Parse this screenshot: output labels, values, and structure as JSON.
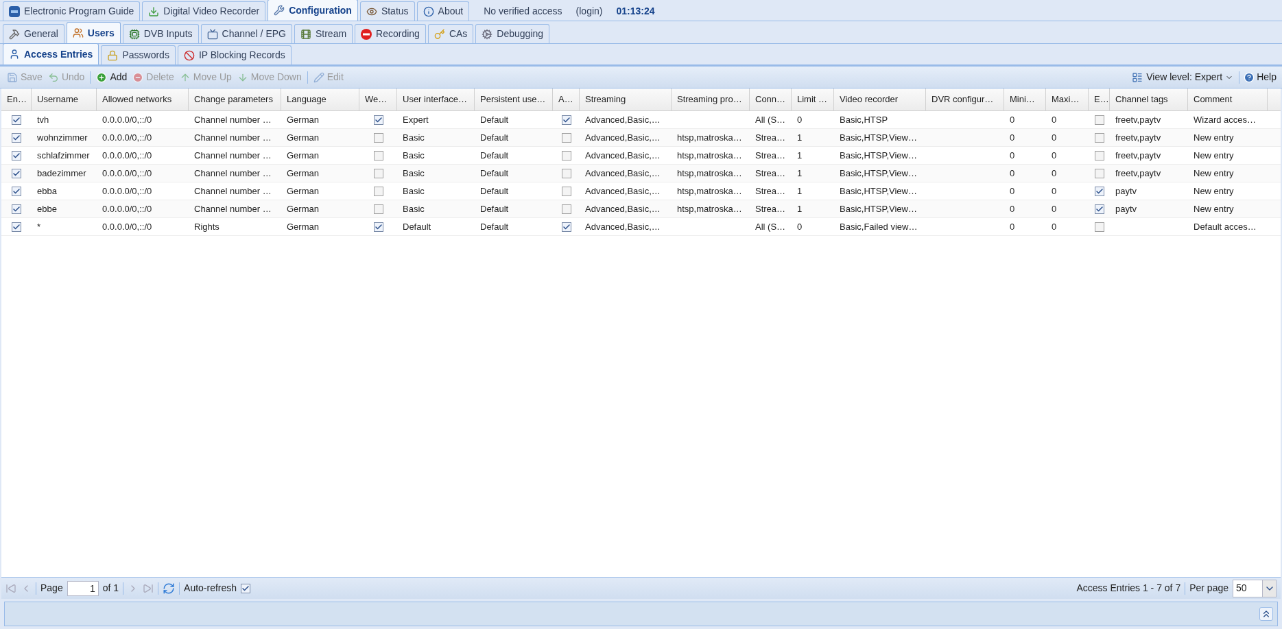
{
  "main_tabs": [
    {
      "label": "Electronic Program Guide",
      "selected": false
    },
    {
      "label": "Digital Video Recorder",
      "selected": false
    },
    {
      "label": "Configuration",
      "selected": true
    },
    {
      "label": "Status",
      "selected": false
    },
    {
      "label": "About",
      "selected": false
    }
  ],
  "session": {
    "access": "No verified access",
    "login": "(login)",
    "time": "01:13:24"
  },
  "config_tabs": [
    {
      "label": "General",
      "selected": false
    },
    {
      "label": "Users",
      "selected": true
    },
    {
      "label": "DVB Inputs",
      "selected": false
    },
    {
      "label": "Channel / EPG",
      "selected": false
    },
    {
      "label": "Stream",
      "selected": false
    },
    {
      "label": "Recording",
      "selected": false
    },
    {
      "label": "CAs",
      "selected": false
    },
    {
      "label": "Debugging",
      "selected": false
    }
  ],
  "user_tabs": [
    {
      "label": "Access Entries",
      "selected": true
    },
    {
      "label": "Passwords",
      "selected": false
    },
    {
      "label": "IP Blocking Records",
      "selected": false
    }
  ],
  "toolbar": [
    {
      "label": "Save",
      "disabled": true
    },
    {
      "label": "Undo",
      "disabled": true
    },
    {
      "label": "Add",
      "disabled": false
    },
    {
      "label": "Delete",
      "disabled": true
    },
    {
      "label": "Move Up",
      "disabled": true
    },
    {
      "label": "Move Down",
      "disabled": true
    },
    {
      "label": "Edit",
      "disabled": true
    }
  ],
  "view_level": "View level: Expert",
  "help": "Help",
  "table": {
    "columns": [
      {
        "label": "En…",
        "kind": "check"
      },
      {
        "label": "Username",
        "kind": "text"
      },
      {
        "label": "Allowed networks",
        "kind": "text"
      },
      {
        "label": "Change parameters",
        "kind": "text"
      },
      {
        "label": "Language",
        "kind": "text"
      },
      {
        "label": "We…",
        "kind": "check"
      },
      {
        "label": "User interface…",
        "kind": "text"
      },
      {
        "label": "Persistent use…",
        "kind": "text"
      },
      {
        "label": "A…",
        "kind": "check"
      },
      {
        "label": "Streaming",
        "kind": "text"
      },
      {
        "label": "Streaming pro…",
        "kind": "text"
      },
      {
        "label": "Conn…",
        "kind": "text"
      },
      {
        "label": "Limit …",
        "kind": "text"
      },
      {
        "label": "Video recorder",
        "kind": "text"
      },
      {
        "label": "DVR configur…",
        "kind": "text"
      },
      {
        "label": "Mini…",
        "kind": "text"
      },
      {
        "label": "Maxi…",
        "kind": "text"
      },
      {
        "label": "E…",
        "kind": "check"
      },
      {
        "label": "Channel tags",
        "kind": "text"
      },
      {
        "label": "Comment",
        "kind": "text"
      }
    ],
    "rows": [
      {
        "cells": [
          {
            "checked": true
          },
          {
            "text": "tvh"
          },
          {
            "text": "0.0.0.0/0,::/0"
          },
          {
            "text": "Channel number …"
          },
          {
            "text": "German"
          },
          {
            "checked": true
          },
          {
            "text": "Expert"
          },
          {
            "text": "Default"
          },
          {
            "checked": true
          },
          {
            "text": "Advanced,Basic,…"
          },
          {},
          {
            "text": "All (S…"
          },
          {
            "text": "0"
          },
          {
            "text": "Basic,HTSP"
          },
          {},
          {
            "text": "0"
          },
          {
            "text": "0"
          },
          {
            "checked": false
          },
          {
            "text": "freetv,paytv"
          },
          {
            "text": "Wizard acces…"
          }
        ]
      },
      {
        "cells": [
          {
            "checked": true
          },
          {
            "text": "wohnzimmer"
          },
          {
            "text": "0.0.0.0/0,::/0"
          },
          {
            "text": "Channel number …"
          },
          {
            "text": "German"
          },
          {
            "checked": false
          },
          {
            "text": "Basic"
          },
          {
            "text": "Default"
          },
          {
            "checked": false
          },
          {
            "text": "Advanced,Basic,…"
          },
          {
            "text": "htsp,matroska…"
          },
          {
            "text": "Strea…"
          },
          {
            "text": "1"
          },
          {
            "text": "Basic,HTSP,View…"
          },
          {},
          {
            "text": "0"
          },
          {
            "text": "0"
          },
          {
            "checked": false
          },
          {
            "text": "freetv,paytv"
          },
          {
            "text": "New entry"
          }
        ]
      },
      {
        "cells": [
          {
            "checked": true
          },
          {
            "text": "schlafzimmer"
          },
          {
            "text": "0.0.0.0/0,::/0"
          },
          {
            "text": "Channel number …"
          },
          {
            "text": "German"
          },
          {
            "checked": false
          },
          {
            "text": "Basic"
          },
          {
            "text": "Default"
          },
          {
            "checked": false
          },
          {
            "text": "Advanced,Basic,…"
          },
          {
            "text": "htsp,matroska…"
          },
          {
            "text": "Strea…"
          },
          {
            "text": "1"
          },
          {
            "text": "Basic,HTSP,View…"
          },
          {},
          {
            "text": "0"
          },
          {
            "text": "0"
          },
          {
            "checked": false
          },
          {
            "text": "freetv,paytv"
          },
          {
            "text": "New entry"
          }
        ]
      },
      {
        "cells": [
          {
            "checked": true
          },
          {
            "text": "badezimmer"
          },
          {
            "text": "0.0.0.0/0,::/0"
          },
          {
            "text": "Channel number …"
          },
          {
            "text": "German"
          },
          {
            "checked": false
          },
          {
            "text": "Basic"
          },
          {
            "text": "Default"
          },
          {
            "checked": false
          },
          {
            "text": "Advanced,Basic,…"
          },
          {
            "text": "htsp,matroska…"
          },
          {
            "text": "Strea…"
          },
          {
            "text": "1"
          },
          {
            "text": "Basic,HTSP,View…"
          },
          {},
          {
            "text": "0"
          },
          {
            "text": "0"
          },
          {
            "checked": false
          },
          {
            "text": "freetv,paytv"
          },
          {
            "text": "New entry"
          }
        ]
      },
      {
        "cells": [
          {
            "checked": true
          },
          {
            "text": "ebba"
          },
          {
            "text": "0.0.0.0/0,::/0"
          },
          {
            "text": "Channel number …"
          },
          {
            "text": "German"
          },
          {
            "checked": false
          },
          {
            "text": "Basic"
          },
          {
            "text": "Default"
          },
          {
            "checked": false
          },
          {
            "text": "Advanced,Basic,…"
          },
          {
            "text": "htsp,matroska…"
          },
          {
            "text": "Strea…"
          },
          {
            "text": "1"
          },
          {
            "text": "Basic,HTSP,View…"
          },
          {},
          {
            "text": "0"
          },
          {
            "text": "0"
          },
          {
            "checked": true
          },
          {
            "text": "paytv"
          },
          {
            "text": "New entry"
          }
        ]
      },
      {
        "cells": [
          {
            "checked": true
          },
          {
            "text": "ebbe"
          },
          {
            "text": "0.0.0.0/0,::/0"
          },
          {
            "text": "Channel number …"
          },
          {
            "text": "German"
          },
          {
            "checked": false
          },
          {
            "text": "Basic"
          },
          {
            "text": "Default"
          },
          {
            "checked": false
          },
          {
            "text": "Advanced,Basic,…"
          },
          {
            "text": "htsp,matroska…"
          },
          {
            "text": "Strea…"
          },
          {
            "text": "1"
          },
          {
            "text": "Basic,HTSP,View…"
          },
          {},
          {
            "text": "0"
          },
          {
            "text": "0"
          },
          {
            "checked": true
          },
          {
            "text": "paytv"
          },
          {
            "text": "New entry"
          }
        ]
      },
      {
        "cells": [
          {
            "checked": true
          },
          {
            "text": "*"
          },
          {
            "text": "0.0.0.0/0,::/0"
          },
          {
            "text": "Rights"
          },
          {
            "text": "German"
          },
          {
            "checked": true
          },
          {
            "text": "Default"
          },
          {
            "text": "Default"
          },
          {
            "checked": true
          },
          {
            "text": "Advanced,Basic,…"
          },
          {},
          {
            "text": "All (S…"
          },
          {
            "text": "0"
          },
          {
            "text": "Basic,Failed view…"
          },
          {},
          {
            "text": "0"
          },
          {
            "text": "0"
          },
          {
            "checked": false
          },
          {},
          {
            "text": "Default acces…"
          }
        ]
      }
    ]
  },
  "pager": {
    "page_label": "Page",
    "page": "1",
    "of": "of 1",
    "auto_refresh": {
      "label": "Auto-refresh",
      "checked": true
    },
    "summary": "Access Entries 1 - 7 of 7",
    "per_page_label": "Per page",
    "per_page": "50"
  }
}
